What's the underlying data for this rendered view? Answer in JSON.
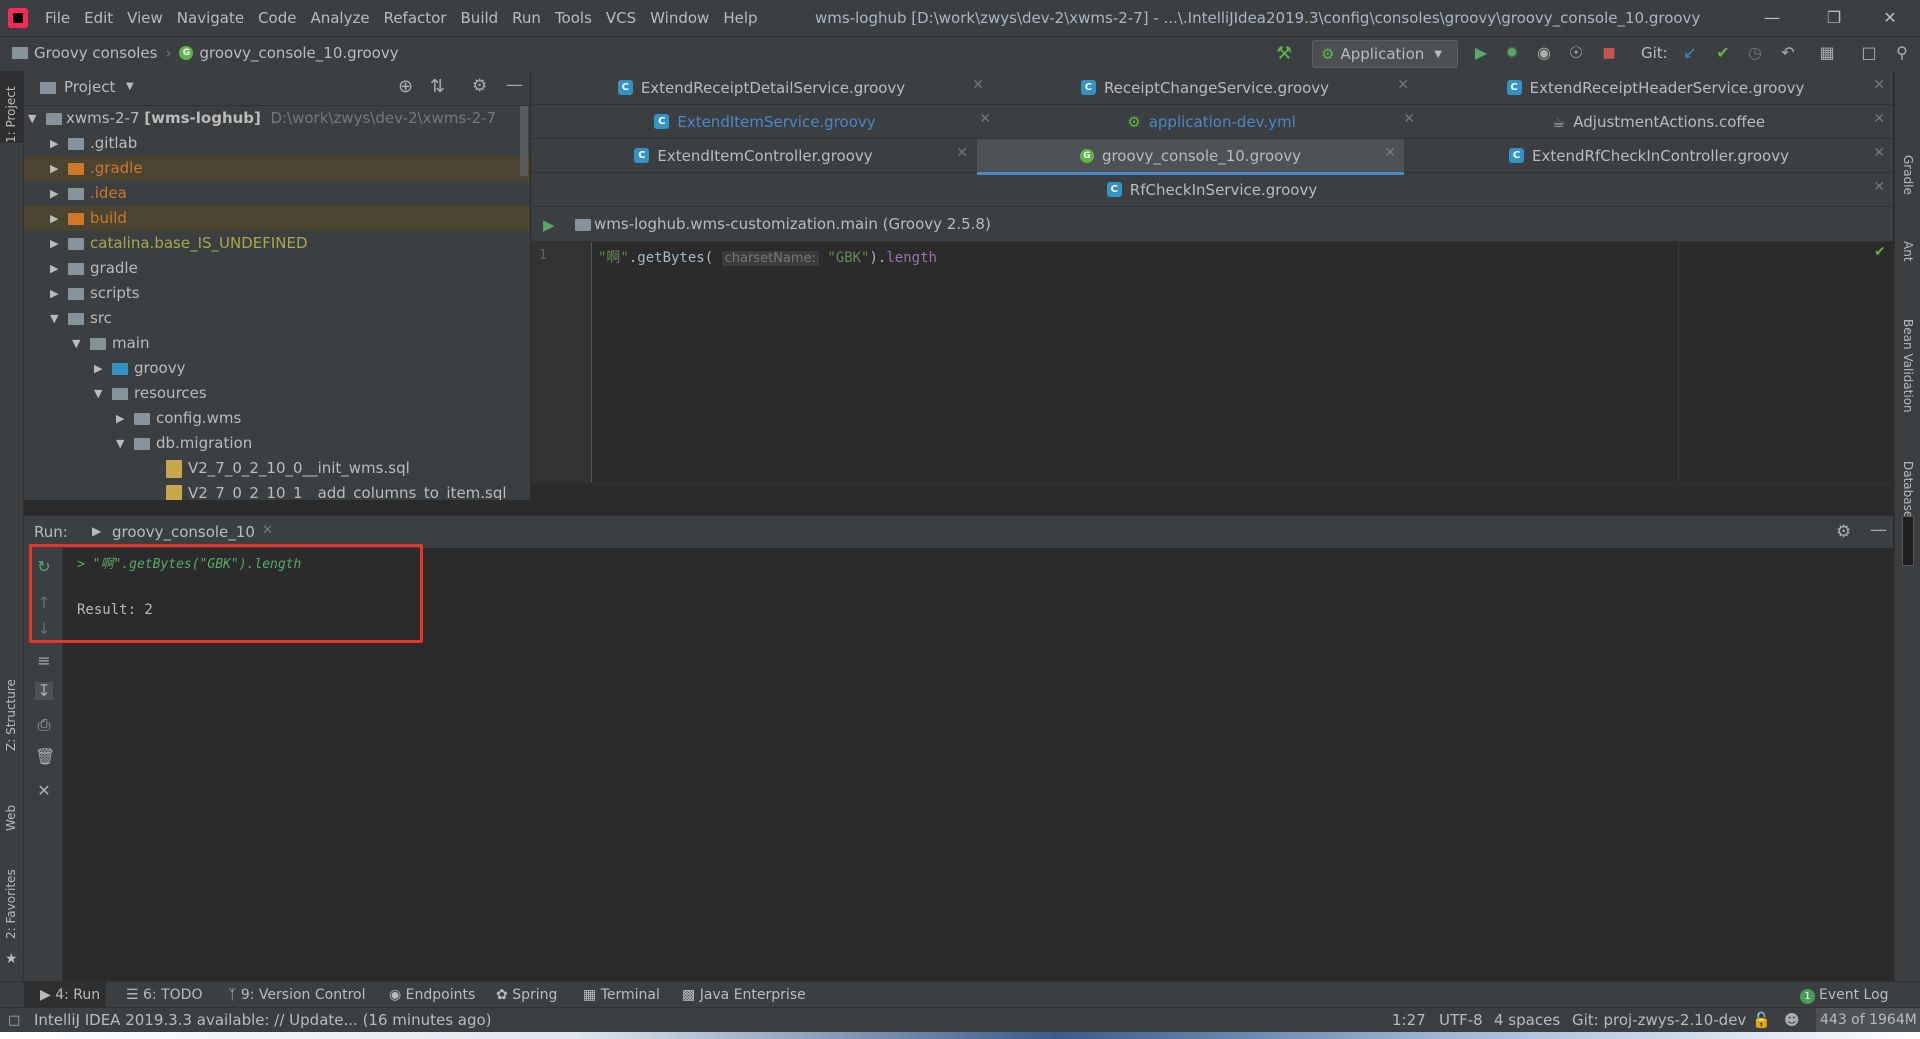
{
  "menu": [
    "File",
    "Edit",
    "View",
    "Navigate",
    "Code",
    "Analyze",
    "Refactor",
    "Build",
    "Run",
    "Tools",
    "VCS",
    "Window",
    "Help"
  ],
  "window_title": "wms-loghub [D:\\work\\zwys\\dev-2\\xwms-2-7] - ...\\.IntelliJIdea2019.3\\config\\consoles\\groovy\\groovy_console_10.groovy",
  "breadcrumb": {
    "root": "Groovy consoles",
    "file": "groovy_console_10.groovy"
  },
  "toolbar": {
    "run_config": "Application",
    "git_label": "Git:"
  },
  "left_stripe": {
    "project": "1: Project",
    "structure": "Z: Structure",
    "web": "Web",
    "favorites": "2: Favorites"
  },
  "right_stripe": {
    "gradle": "Gradle",
    "ant": "Ant",
    "bean_validation": "Bean Validation",
    "database": "Database"
  },
  "project": {
    "header": "Project",
    "root_name": "xwms-2-7",
    "root_module": "[wms-loghub]",
    "root_path": "D:\\work\\zwys\\dev-2\\xwms-2-7",
    "nodes": [
      ".gitlab",
      ".gradle",
      ".idea",
      "build",
      "catalina.base_IS_UNDEFINED",
      "gradle",
      "scripts",
      "src",
      "main",
      "groovy",
      "resources",
      "config.wms",
      "db.migration",
      "V2_7_0_2_10_0__init_wms.sql",
      "V2_7_0_2_10_1__add_columns_to_item.sql"
    ]
  },
  "tabs": {
    "r1": [
      "ExtendReceiptDetailService.groovy",
      "ReceiptChangeService.groovy",
      "ExtendReceiptHeaderService.groovy"
    ],
    "r2": [
      "ExtendItemService.groovy",
      "application-dev.yml",
      "AdjustmentActions.coffee"
    ],
    "r3": [
      "ExtendItemController.groovy",
      "groovy_console_10.groovy",
      "ExtendRfCheckInController.groovy"
    ],
    "r4": [
      "RfCheckInService.groovy"
    ]
  },
  "console_bar": {
    "module": "wms-loghub.wms-customization.main (Groovy 2.5.8)"
  },
  "editor": {
    "line_number": "1",
    "code_string": "\"啊\"",
    "code_method": ".getBytes(",
    "param_hint": "charsetName:",
    "code_arg": "\"GBK\"",
    "code_close": ").",
    "code_prop": "length"
  },
  "run": {
    "label": "Run:",
    "tab": "groovy_console_10",
    "echo_prompt": ">",
    "echo": "\"啊\".getBytes(\"GBK\").length",
    "result": "Result: 2"
  },
  "bottom_tabs": {
    "run": "4: Run",
    "todo": "6: TODO",
    "vcs": "9: Version Control",
    "endpoints": "Endpoints",
    "spring": "Spring",
    "terminal": "Terminal",
    "java_ee": "Java Enterprise",
    "event_badge": "1",
    "event_log": "Event Log"
  },
  "status": {
    "message": "IntelliJ IDEA 2019.3.3 available: // Update... (16 minutes ago)",
    "position": "1:27",
    "encoding": "UTF-8",
    "indent": "4 spaces",
    "git": "Git: proj-zwys-2.10-dev",
    "memory": "443 of 1964M"
  },
  "colors": {
    "highlight": "#e8342a",
    "string": "#6a8759",
    "keyword_blue": "#4a88c7",
    "excluded": "#d0782a"
  }
}
